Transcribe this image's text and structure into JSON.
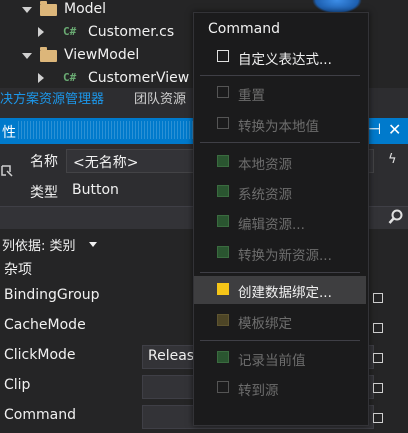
{
  "solution_tree": {
    "items": [
      {
        "label": "Model",
        "kind": "folder"
      },
      {
        "label": "Customer.cs",
        "kind": "cs-file",
        "icon_text": "C#"
      },
      {
        "label": "ViewModel",
        "kind": "folder"
      },
      {
        "label": "CustomerView",
        "kind": "cs-file",
        "icon_text": "C#"
      }
    ]
  },
  "tabs": [
    {
      "label": "决方案资源管理器",
      "active": true
    },
    {
      "label": "团队资源",
      "active": false
    }
  ],
  "properties": {
    "title": "性",
    "name_label": "名称",
    "name_value": "<无名称>",
    "type_label": "类型",
    "type_value": "Button",
    "arrange_by": "列依据: 类别",
    "category": "杂项",
    "rows": [
      {
        "name": "BindingGroup",
        "value": ""
      },
      {
        "name": "CacheMode",
        "value": ""
      },
      {
        "name": "ClickMode",
        "value": "Releas"
      },
      {
        "name": "Clip",
        "value": ""
      },
      {
        "name": "Command",
        "value": ""
      }
    ]
  },
  "context_menu": {
    "header": "Command",
    "items": [
      {
        "label": "自定义表达式...",
        "enabled": true,
        "box": "outline"
      },
      {
        "label": "重置",
        "enabled": false,
        "box": "outline-dim"
      },
      {
        "label": "转换为本地值",
        "enabled": false,
        "box": "outline-dim"
      },
      {
        "label": "本地资源",
        "enabled": false,
        "box": "green"
      },
      {
        "label": "系统资源",
        "enabled": false,
        "box": "green"
      },
      {
        "label": "编辑资源...",
        "enabled": false,
        "box": "green"
      },
      {
        "label": "转换为新资源...",
        "enabled": false,
        "box": "green"
      },
      {
        "label": "创建数据绑定...",
        "enabled": true,
        "box": "yellow",
        "hover": true
      },
      {
        "label": "模板绑定",
        "enabled": false,
        "box": "olive"
      },
      {
        "label": "记录当前值",
        "enabled": false,
        "box": "green"
      },
      {
        "label": "转到源",
        "enabled": false,
        "box": "outline-dim"
      }
    ]
  },
  "colors": {
    "accent": "#007acc",
    "background": "#252526",
    "menu_background": "#1b1b1c",
    "highlight_yellow": "#f5c518"
  }
}
